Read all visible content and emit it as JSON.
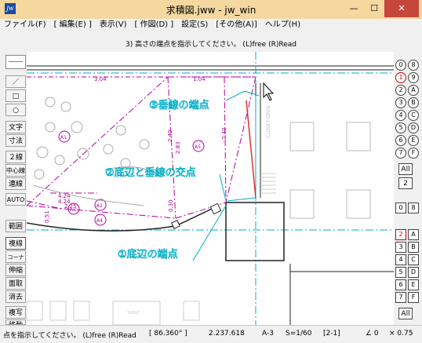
{
  "window": {
    "title": "求積図.jww - jw_win",
    "icon_label": "jw",
    "minimize": "—",
    "maximize": "☐",
    "close": "✕"
  },
  "menu": [
    "ファイル(F)",
    "[ 編集(E) ]",
    "表示(V)",
    "[ 作図(D) ]",
    "設定(S)",
    "[その他(A)]",
    "ヘルプ(H)"
  ],
  "prompt": "3) 高さの端点を指示してください。 (L)free (R)Read",
  "left_tools": [
    "／",
    "□",
    "○",
    "文字",
    "寸法",
    "２線",
    "中心線",
    "連線",
    "AUTO",
    "範囲",
    "複線",
    "コーナー",
    "伸縮",
    "面取",
    "消去",
    "複写",
    "移動"
  ],
  "right_layers": {
    "top_rows": [
      [
        "0",
        "8"
      ],
      [
        "1",
        "9"
      ],
      [
        "2",
        "A"
      ],
      [
        "3",
        "B"
      ],
      [
        "4",
        "C"
      ],
      [
        "5",
        "D"
      ],
      [
        "6",
        "E"
      ],
      [
        "7",
        "F"
      ]
    ],
    "top_all": "All",
    "top_num": "2",
    "bottom_header": [
      "0",
      "8"
    ],
    "bottom_rows": [
      [
        "2",
        "A"
      ],
      [
        "3",
        "B"
      ],
      [
        "4",
        "C"
      ],
      [
        "5",
        "D"
      ],
      [
        "6",
        "E"
      ],
      [
        "7",
        "F"
      ]
    ],
    "bottom_all": "All"
  },
  "drawing": {
    "dims": {
      "d1": "3.04",
      "d2": "1.04",
      "d3": "2.40",
      "d4": "2.83",
      "d5": "2.40",
      "d6": "0.30",
      "d7": "0.51",
      "d8": "4.24",
      "d9": "4.24",
      "d10": "2.25"
    },
    "circles": [
      "A1",
      "A2",
      "A3",
      "A4",
      "A5"
    ],
    "annotations": {
      "a3": "③垂線の端点",
      "a2": "②底辺と垂線の交点",
      "a1": "①底辺の端点"
    },
    "vertical_text": "CLOSET-OPEN",
    "table_label": "TABLE"
  },
  "status": {
    "message": "点を指示してください。 (L)free (R)Read",
    "angle": "[ 86.360° ]",
    "length": "2.237.618",
    "paper": "A-3",
    "scale": "S=1/60",
    "layer": "[2-1]",
    "rotation": "∠ 0",
    "zoom": "× 0.75"
  },
  "colors": {
    "magenta": "#b4009e",
    "cyan": "#00aec8",
    "red": "#e03030"
  }
}
